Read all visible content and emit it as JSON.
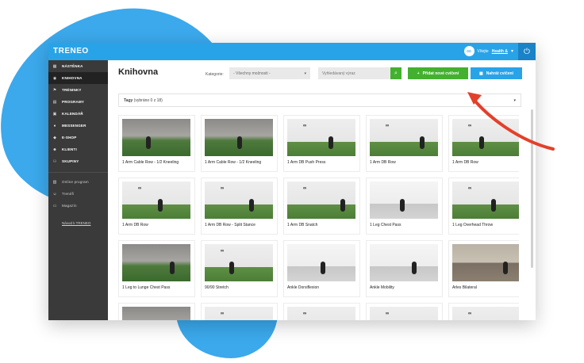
{
  "app": {
    "logo": "TRENEO",
    "accent": "#29a3e8",
    "green": "#43b12f"
  },
  "user": {
    "greeting": "Vítejte",
    "name": "Health &",
    "avatar_icon": "logo-icon"
  },
  "sidebar": {
    "items": [
      {
        "label": "NÁSTĚNKA",
        "icon": "dashboard-icon"
      },
      {
        "label": "KNIHOVNA",
        "icon": "library-icon",
        "active": true
      },
      {
        "label": "TRÉNINKY",
        "icon": "workout-icon"
      },
      {
        "label": "PROGRAMY",
        "icon": "programs-icon"
      },
      {
        "label": "KALENDÁŘ",
        "icon": "calendar-icon"
      },
      {
        "label": "MESSENGER",
        "icon": "chat-icon"
      },
      {
        "label": "E-SHOP",
        "icon": "shop-icon"
      },
      {
        "label": "KLIENTI",
        "icon": "clients-icon"
      },
      {
        "label": "SKUPINY",
        "icon": "groups-icon"
      }
    ],
    "secondary": [
      {
        "label": "Online program",
        "icon": "online-icon"
      },
      {
        "label": "Trenéři",
        "icon": "trainers-icon"
      },
      {
        "label": "Magazín",
        "icon": "magazine-icon"
      }
    ],
    "guide_link": "Návod k TRENEO"
  },
  "main": {
    "title": "Knihovna",
    "category_label": "Kategorie:",
    "category_value": "- Všechny možnosti -",
    "search_placeholder": "Vyhledávaný výraz",
    "new_exercise": "Přidat nové cvičení",
    "import_exercise": "Nahrát cvičení",
    "tags_label": "Tagy",
    "tags_selected": "(vybráno 0 z 18)"
  },
  "exercises": [
    {
      "name": "1 Arm Cable Row - 1/2 Kneeling",
      "thumb": "gym"
    },
    {
      "name": "1 Arm Cable Row - 1/2 Kneeling",
      "thumb": "gym"
    },
    {
      "name": "1 Arm DB Push Press",
      "thumb": "studio"
    },
    {
      "name": "1 Arm DB Row",
      "thumb": "studio"
    },
    {
      "name": "1 Arm DB Row",
      "thumb": "studio"
    },
    {
      "name": "1 Arm DB Row",
      "thumb": "studio"
    },
    {
      "name": "1 Arm DB Row - Split Stance",
      "thumb": "studio"
    },
    {
      "name": "1 Arm DB Snatch",
      "thumb": "studio"
    },
    {
      "name": "1 Leg Chest Pass",
      "thumb": "light"
    },
    {
      "name": "1 Leg Overhead Throw",
      "thumb": "studio"
    },
    {
      "name": "1 Leg to Lunge Chest Pass",
      "thumb": "gym"
    },
    {
      "name": "90/90 Stretch",
      "thumb": "studio"
    },
    {
      "name": "Ankle Dorsiflexion",
      "thumb": "light"
    },
    {
      "name": "Ankle Mobility",
      "thumb": "light"
    },
    {
      "name": "Arles Bilateral",
      "thumb": "gym2"
    },
    {
      "name": "",
      "thumb": "gym"
    },
    {
      "name": "",
      "thumb": "studio"
    },
    {
      "name": "",
      "thumb": "studio"
    },
    {
      "name": "",
      "thumb": "studio"
    },
    {
      "name": "",
      "thumb": "studio"
    }
  ]
}
